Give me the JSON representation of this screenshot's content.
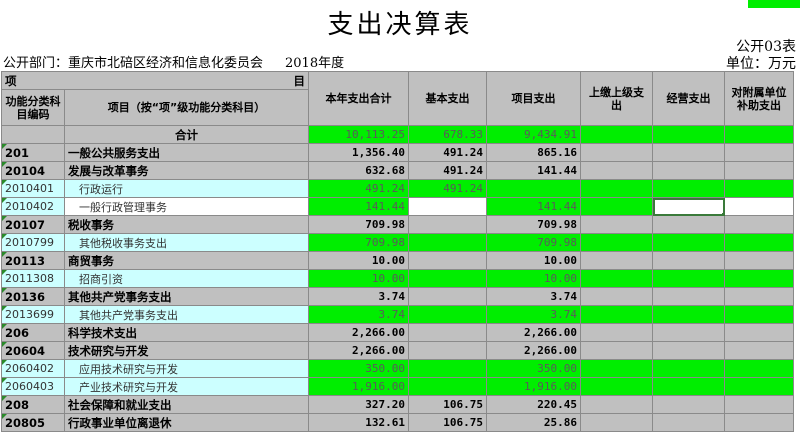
{
  "doc": {
    "title": "支出决算表",
    "dept": "公开部门：重庆市北碚区经济和信息化委员会",
    "year": "2018年度",
    "table_no": "公开03表",
    "unit": "单位：万元"
  },
  "header": {
    "xiang": "项",
    "mu": "目",
    "code_col": "功能分类科目编码",
    "name_col": "项目（按“项”级功能分类科目）",
    "cols": [
      "本年支出合计",
      "基本支出",
      "项目支出",
      "上缴上级支出",
      "经营支出",
      "对附属单位补助支出"
    ]
  },
  "rows": [
    {
      "code": "",
      "name": "合计",
      "total": "10,113.25",
      "basic": "678.33",
      "project": "9,434.91",
      "style": "sum"
    },
    {
      "code": "201",
      "name": "一般公共服务支出",
      "total": "1,356.40",
      "basic": "491.24",
      "project": "865.16",
      "style": "cat"
    },
    {
      "code": "20104",
      "name": "发展与改革事务",
      "total": "632.68",
      "basic": "491.24",
      "project": "141.44",
      "style": "cat"
    },
    {
      "code": "2010401",
      "name": "行政运行",
      "total": "491.24",
      "basic": "491.24",
      "project": "",
      "style": "sub"
    },
    {
      "code": "2010402",
      "name": "一般行政管理事务",
      "total": "141.44",
      "basic": "",
      "project": "141.44",
      "style": "sub2"
    },
    {
      "code": "20107",
      "name": "税收事务",
      "total": "709.98",
      "basic": "",
      "project": "709.98",
      "style": "cat"
    },
    {
      "code": "2010799",
      "name": "其他税收事务支出",
      "total": "709.98",
      "basic": "",
      "project": "709.98",
      "style": "sub"
    },
    {
      "code": "20113",
      "name": "商贸事务",
      "total": "10.00",
      "basic": "",
      "project": "10.00",
      "style": "cat"
    },
    {
      "code": "2011308",
      "name": "招商引资",
      "total": "10.00",
      "basic": "",
      "project": "10.00",
      "style": "sub"
    },
    {
      "code": "20136",
      "name": "其他共产党事务支出",
      "total": "3.74",
      "basic": "",
      "project": "3.74",
      "style": "cat"
    },
    {
      "code": "2013699",
      "name": "其他共产党事务支出",
      "total": "3.74",
      "basic": "",
      "project": "3.74",
      "style": "sub"
    },
    {
      "code": "206",
      "name": "科学技术支出",
      "total": "2,266.00",
      "basic": "",
      "project": "2,266.00",
      "style": "cat"
    },
    {
      "code": "20604",
      "name": "技术研究与开发",
      "total": "2,266.00",
      "basic": "",
      "project": "2,266.00",
      "style": "cat"
    },
    {
      "code": "2060402",
      "name": "应用技术研究与开发",
      "total": "350.00",
      "basic": "",
      "project": "350.00",
      "style": "sub"
    },
    {
      "code": "2060403",
      "name": "产业技术研究与开发",
      "total": "1,916.00",
      "basic": "",
      "project": "1,916.00",
      "style": "sub"
    },
    {
      "code": "208",
      "name": "社会保障和就业支出",
      "total": "327.20",
      "basic": "106.75",
      "project": "220.45",
      "style": "cat"
    },
    {
      "code": "20805",
      "name": "行政事业单位离退休",
      "total": "132.61",
      "basic": "106.75",
      "project": "25.86",
      "style": "cat"
    }
  ],
  "colors": {
    "green": "#00ee00",
    "gray": "#c0c0c0",
    "cyan": "#ccffff"
  }
}
